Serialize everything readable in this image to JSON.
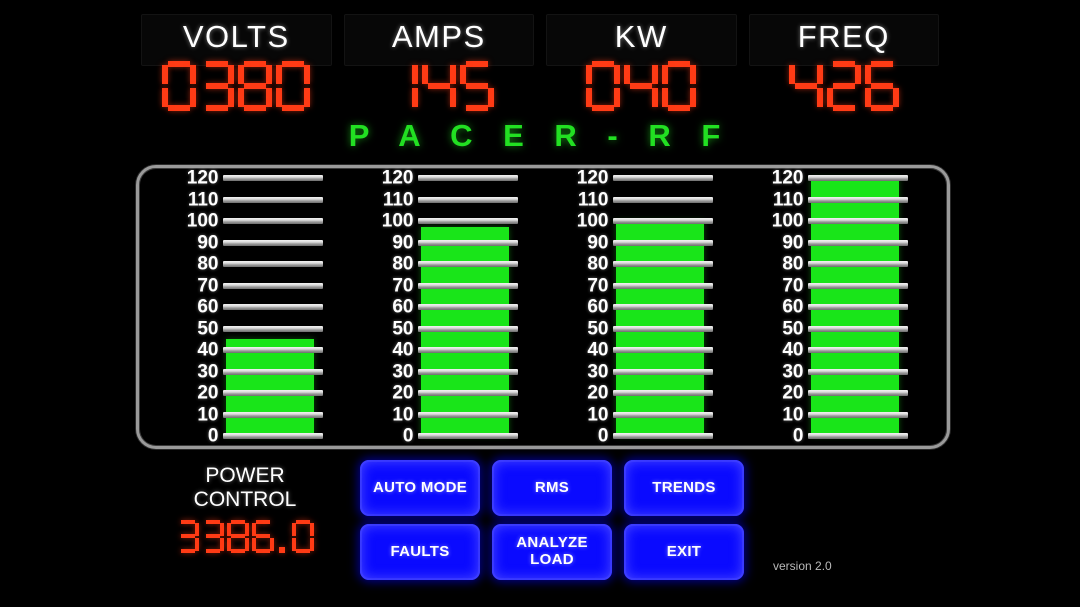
{
  "brand": "P A C E R - R F",
  "colors": {
    "background": "#000000",
    "segment_red": "#ff3b15",
    "bar_green": "#19e519",
    "brand_green": "#22e022",
    "button_blue": "#0a0aff",
    "label_white": "#ffffff",
    "frame_gray": "#9a9a9a"
  },
  "readouts": [
    {
      "label": "VOLTS",
      "value": "0380"
    },
    {
      "label": "AMPS",
      "value": "145"
    },
    {
      "label": "KW",
      "value": "040"
    },
    {
      "label": "FREQ",
      "value": "426"
    }
  ],
  "gauges": [
    {
      "name": "VOLTS",
      "value": 45,
      "min": 0,
      "max": 120
    },
    {
      "name": "AMPS",
      "value": 97,
      "min": 0,
      "max": 120
    },
    {
      "name": "KW",
      "value": 100,
      "min": 0,
      "max": 120
    },
    {
      "name": "FREQ",
      "value": 120,
      "min": 0,
      "max": 120
    }
  ],
  "scale_ticks": [
    0,
    10,
    20,
    30,
    40,
    50,
    60,
    70,
    80,
    90,
    100,
    110,
    120
  ],
  "power_control": {
    "label_line1": "POWER",
    "label_line2": "CONTROL",
    "value": "3386.0"
  },
  "buttons": [
    {
      "id": "auto-mode",
      "label": "AUTO MODE"
    },
    {
      "id": "rms",
      "label": "RMS"
    },
    {
      "id": "trends",
      "label": "TRENDS"
    },
    {
      "id": "faults",
      "label": "FAULTS"
    },
    {
      "id": "analyze-load",
      "label": "ANALYZE\nLOAD"
    },
    {
      "id": "exit",
      "label": "EXIT"
    }
  ],
  "version": "version 2.0",
  "chart_data": {
    "type": "bar",
    "title": "PACER-RF Live Metering",
    "categories": [
      "VOLTS",
      "AMPS",
      "KW",
      "FREQ"
    ],
    "values": [
      45,
      97,
      100,
      120
    ],
    "digital_readings": [
      "0380",
      "145",
      "040",
      "426"
    ],
    "ylabel": "",
    "xlabel": "",
    "ylim": [
      0,
      120
    ],
    "ytick_labels": [
      0,
      10,
      20,
      30,
      40,
      50,
      60,
      70,
      80,
      90,
      100,
      110,
      120
    ],
    "grid": true,
    "legend": "none",
    "orientation": "vertical",
    "bar_color": "#19e519"
  }
}
